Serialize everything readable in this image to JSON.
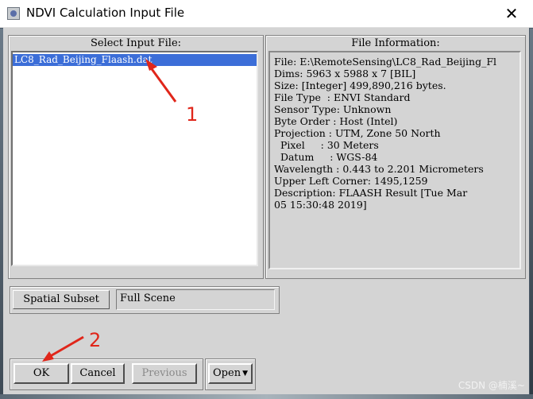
{
  "window": {
    "title": "NDVI Calculation Input File",
    "close_glyph": "✕"
  },
  "select_panel": {
    "title": "Select Input File:",
    "items": [
      "LC8_Rad_Beijing_Flaash.dat"
    ]
  },
  "info_panel": {
    "title": "File Information:",
    "lines": [
      "File: E:\\RemoteSensing\\LC8_Rad_Beijing_Fl",
      "Dims: 5963 x 5988 x 7 [BIL]",
      "Size: [Integer] 499,890,216 bytes.",
      "File Type  : ENVI Standard",
      "Sensor Type: Unknown",
      "Byte Order : Host (Intel)",
      "Projection : UTM, Zone 50 North",
      "  Pixel     : 30 Meters",
      "  Datum     : WGS-84",
      "Wavelength : 0.443 to 2.201 Micrometers",
      "Upper Left Corner: 1495,1259",
      "Description: FLAASH Result [Tue Mar",
      "05 15:30:48 2019]"
    ]
  },
  "subset": {
    "button_label": "Spatial Subset",
    "value": "Full Scene"
  },
  "buttons": {
    "ok": "OK",
    "cancel": "Cancel",
    "previous": "Previous",
    "open": "Open"
  },
  "annotations": {
    "label_1": "1",
    "label_2": "2",
    "color": "#e0261a"
  },
  "watermark": "CSDN @楠溪~",
  "icons": {
    "app": "app-icon",
    "close": "close-icon",
    "open_menu": "caret-down-icon"
  },
  "colors": {
    "selection": "#3c6ed8",
    "dialog_bg": "#d4d4d4"
  }
}
